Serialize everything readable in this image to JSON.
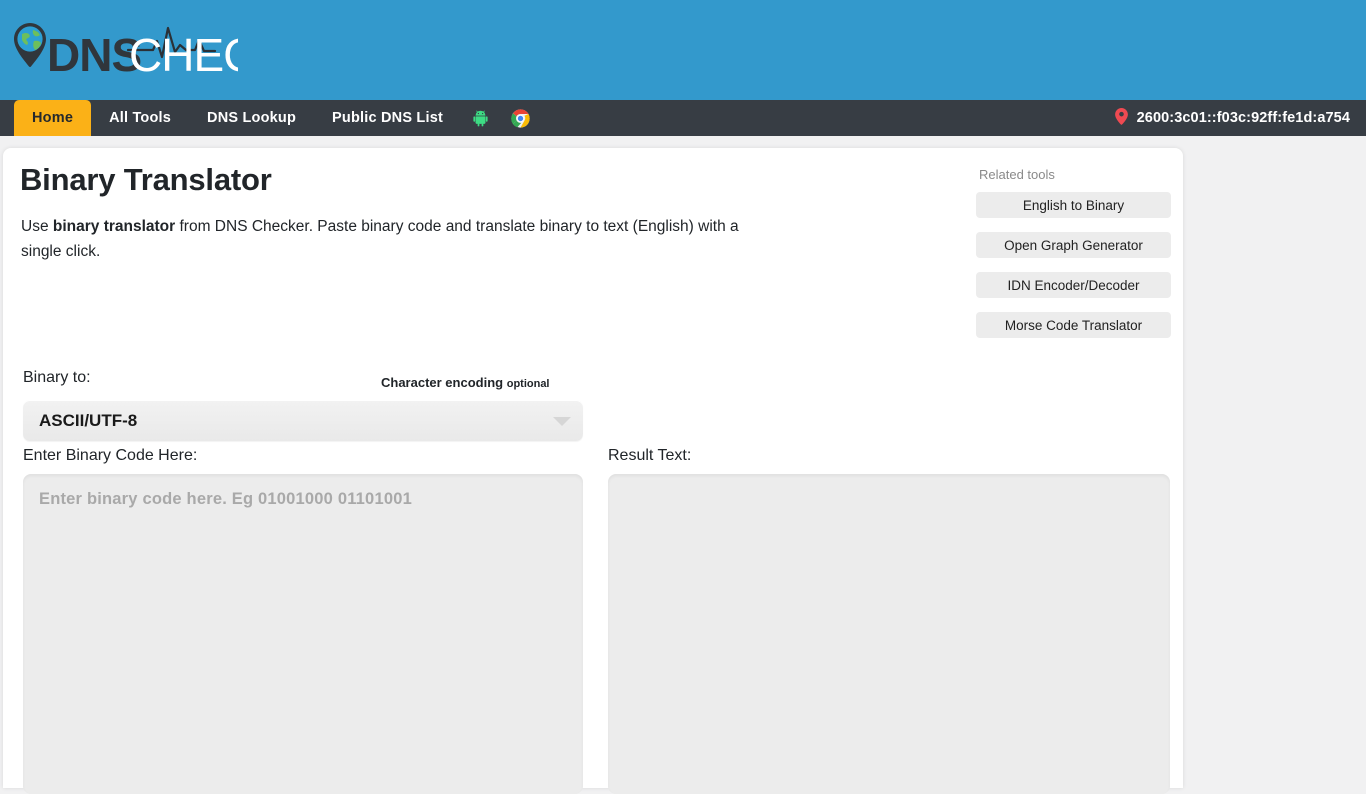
{
  "header": {
    "logo_text_bold": "DNS",
    "logo_text_light": "CHECKER",
    "logo_icon": "globe-pin-icon"
  },
  "nav": {
    "items": [
      {
        "label": "Home",
        "active": true
      },
      {
        "label": "All Tools",
        "active": false
      },
      {
        "label": "DNS Lookup",
        "active": false
      },
      {
        "label": "Public DNS List",
        "active": false
      }
    ],
    "icons": [
      {
        "name": "android-icon"
      },
      {
        "name": "chrome-icon"
      }
    ],
    "ip": {
      "icon": "location-pin-icon",
      "address": "2600:3c01::f03c:92ff:fe1d:a754"
    }
  },
  "main": {
    "title": "Binary Translator",
    "description_prefix": "Use ",
    "description_bold": "binary translator",
    "description_suffix": " from DNS Checker. Paste binary code and translate binary to text (English) with a single click."
  },
  "related": {
    "label": "Related tools",
    "items": [
      {
        "label": "English to Binary"
      },
      {
        "label": "Open Graph Generator"
      },
      {
        "label": "IDN Encoder/Decoder"
      },
      {
        "label": "Morse Code Translator"
      }
    ]
  },
  "form": {
    "binary_to_label": "Binary to:",
    "encoding_label": "Character encoding",
    "encoding_optional": "optional",
    "encoding_value": "ASCII/UTF-8",
    "encoding_options": [
      "ASCII/UTF-8"
    ],
    "input_label": "Enter Binary Code Here:",
    "input_placeholder": "Enter binary code here. Eg 01001000 01101001",
    "input_value": "",
    "output_label": "Result Text:",
    "output_value": ""
  },
  "colors": {
    "header_blue": "#3399cc",
    "nav_dark": "#373d44",
    "active_tab_orange": "#fbb117",
    "page_bg": "#f1f1f2",
    "card_bg": "#ffffff",
    "field_bg": "#ececec",
    "pin_red": "#ef4a52"
  }
}
